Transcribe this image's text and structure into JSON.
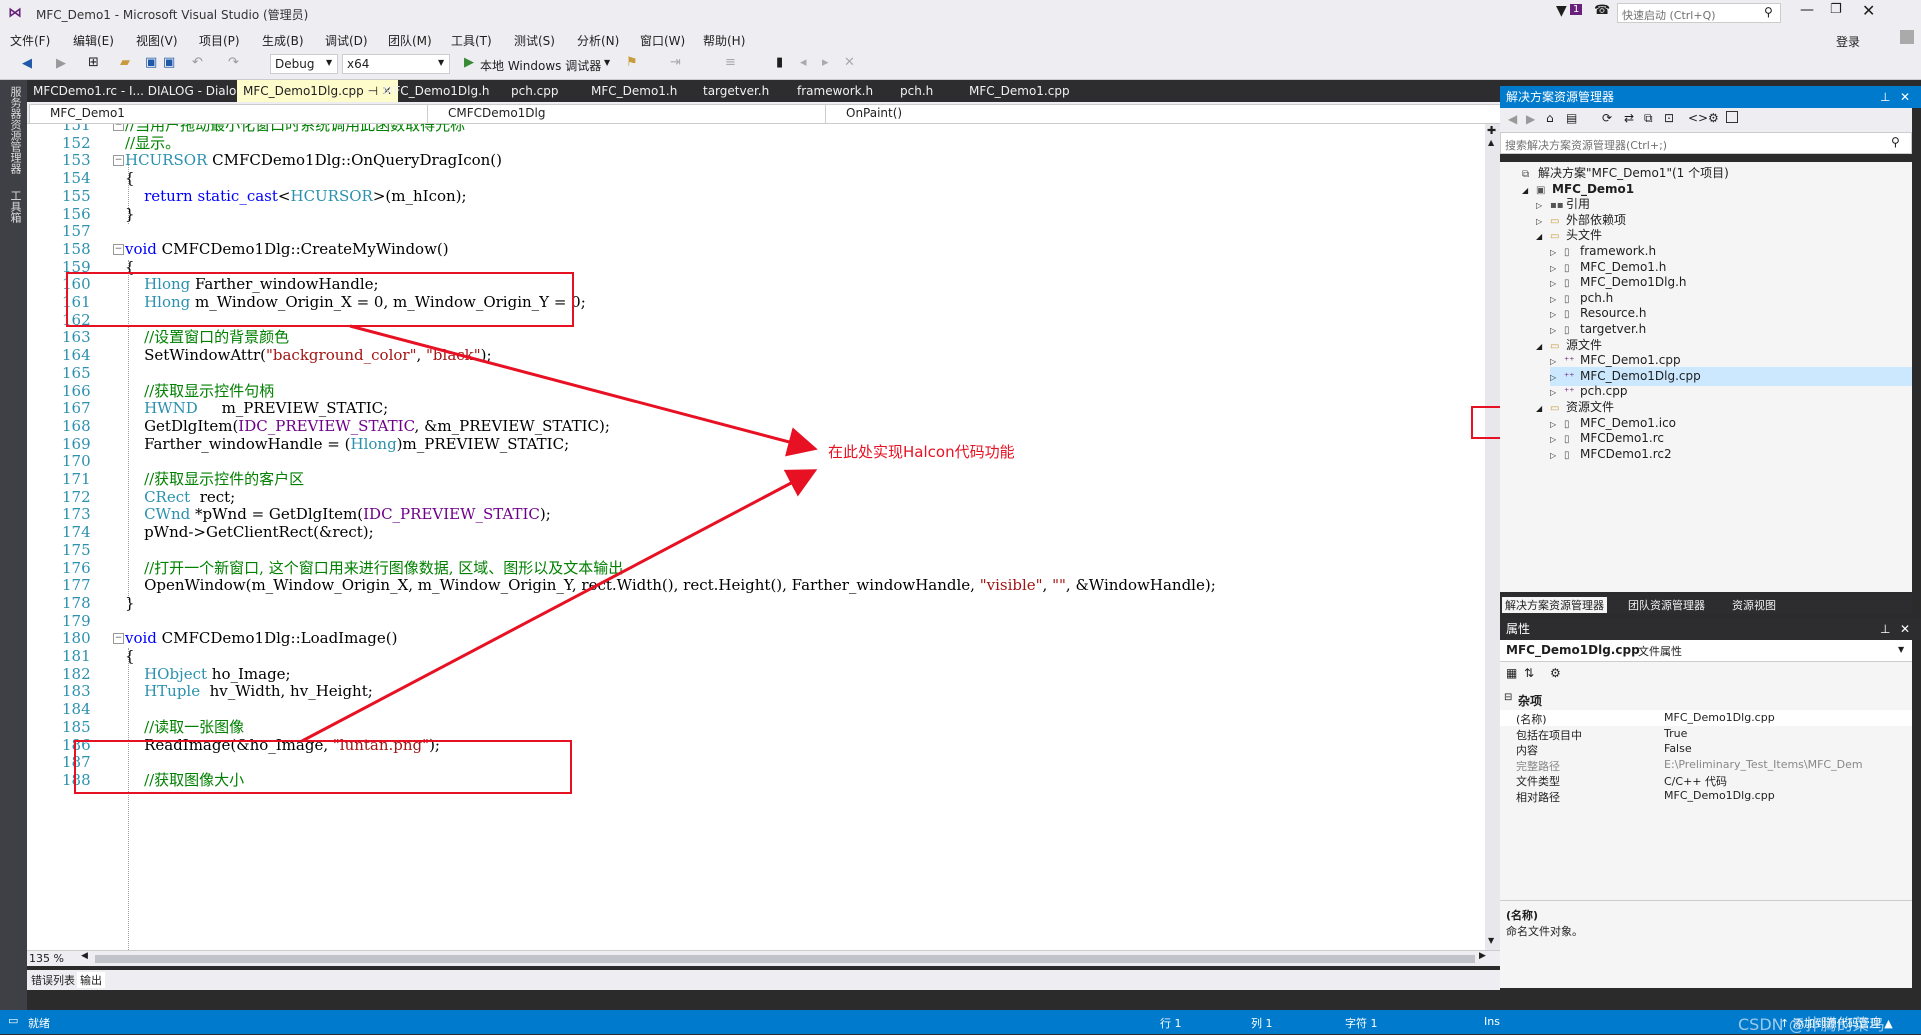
{
  "window": {
    "title": "MFC_Demo1 - Microsoft Visual Studio (管理员)",
    "quick_launch_placeholder": "快速启动 (Ctrl+Q)",
    "notification_count": "1",
    "login_label": "登录"
  },
  "menu": [
    "文件(F)",
    "编辑(E)",
    "视图(V)",
    "项目(P)",
    "生成(B)",
    "调试(D)",
    "团队(M)",
    "工具(T)",
    "测试(S)",
    "分析(N)",
    "窗口(W)",
    "帮助(H)"
  ],
  "toolbar": {
    "config": "Debug",
    "platform": "x64",
    "run_label": "本地 Windows 调试器"
  },
  "left_strip": {
    "label1": "服务器资源管理器",
    "label2": "工具箱"
  },
  "tabs": [
    "MFCDemo1.rc - I... DIALOG - Dialog",
    "MFC_Demo1Dlg.cpp",
    "MFC_Demo1Dlg.h",
    "pch.cpp",
    "MFC_Demo1.h",
    "targetver.h",
    "framework.h",
    "pch.h",
    "MFC_Demo1.cpp"
  ],
  "active_tab_index": 1,
  "nav": {
    "project": "MFC_Demo1",
    "class": "CMFCDemo1Dlg",
    "member": "OnPaint()"
  },
  "code": [
    {
      "n": "151",
      "t": [
        [
          "cm",
          "//当用户拖动最小化窗口时系统调用此函数取得光标"
        ]
      ]
    },
    {
      "n": "152",
      "t": [
        [
          "cm",
          "//显示。"
        ]
      ]
    },
    {
      "n": "153",
      "t": [
        [
          "ty",
          "HCURSOR"
        ],
        [
          "fn",
          " CMFCDemo1Dlg::OnQueryDragIcon()"
        ]
      ]
    },
    {
      "n": "154",
      "t": [
        [
          "fn",
          "{"
        ]
      ]
    },
    {
      "n": "155",
      "t": [
        [
          "fn",
          "    "
        ],
        [
          "kw",
          "return"
        ],
        [
          "fn",
          " "
        ],
        [
          "kw",
          "static_cast"
        ],
        [
          "fn",
          "<"
        ],
        [
          "ty",
          "HCURSOR"
        ],
        [
          "fn",
          ">(m_hIcon);"
        ]
      ]
    },
    {
      "n": "156",
      "t": [
        [
          "fn",
          "}"
        ]
      ]
    },
    {
      "n": "157",
      "t": []
    },
    {
      "n": "158",
      "t": [
        [
          "kw",
          "void"
        ],
        [
          "fn",
          " CMFCDemo1Dlg::CreateMyWindow()"
        ]
      ]
    },
    {
      "n": "159",
      "t": [
        [
          "fn",
          "{"
        ]
      ]
    },
    {
      "n": "160",
      "t": [
        [
          "fn",
          "    "
        ],
        [
          "ty",
          "Hlong"
        ],
        [
          "fn",
          " Farther_windowHandle;"
        ]
      ]
    },
    {
      "n": "161",
      "t": [
        [
          "fn",
          "    "
        ],
        [
          "ty",
          "Hlong"
        ],
        [
          "fn",
          " m_Window_Origin_X = 0, m_Window_Origin_Y = 0;"
        ]
      ]
    },
    {
      "n": "162",
      "t": []
    },
    {
      "n": "163",
      "t": [
        [
          "fn",
          "    "
        ],
        [
          "cm",
          "//设置窗口的背景颜色"
        ]
      ]
    },
    {
      "n": "164",
      "t": [
        [
          "fn",
          "    SetWindowAttr("
        ],
        [
          "st",
          "\"background_color\""
        ],
        [
          "fn",
          ", "
        ],
        [
          "st",
          "\"black\""
        ],
        [
          "fn",
          ");"
        ]
      ]
    },
    {
      "n": "165",
      "t": []
    },
    {
      "n": "166",
      "t": [
        [
          "fn",
          "    "
        ],
        [
          "cm",
          "//获取显示控件句柄"
        ]
      ]
    },
    {
      "n": "167",
      "t": [
        [
          "fn",
          "    "
        ],
        [
          "ty",
          "HWND"
        ],
        [
          "fn",
          "     m_PREVIEW_STATIC;"
        ]
      ]
    },
    {
      "n": "168",
      "t": [
        [
          "fn",
          "    GetDlgItem("
        ],
        [
          "mc",
          "IDC_PREVIEW_STATIC"
        ],
        [
          "fn",
          ", &m_PREVIEW_STATIC);"
        ]
      ]
    },
    {
      "n": "169",
      "t": [
        [
          "fn",
          "    Farther_windowHandle = ("
        ],
        [
          "ty",
          "Hlong"
        ],
        [
          "fn",
          ")m_PREVIEW_STATIC;"
        ]
      ]
    },
    {
      "n": "170",
      "t": []
    },
    {
      "n": "171",
      "t": [
        [
          "fn",
          "    "
        ],
        [
          "cm",
          "//获取显示控件的客户区"
        ]
      ]
    },
    {
      "n": "172",
      "t": [
        [
          "fn",
          "    "
        ],
        [
          "ty",
          "CRect"
        ],
        [
          "fn",
          "  rect;"
        ]
      ]
    },
    {
      "n": "173",
      "t": [
        [
          "fn",
          "    "
        ],
        [
          "ty",
          "CWnd"
        ],
        [
          "fn",
          " *pWnd = GetDlgItem("
        ],
        [
          "mc",
          "IDC_PREVIEW_STATIC"
        ],
        [
          "fn",
          ");"
        ]
      ]
    },
    {
      "n": "174",
      "t": [
        [
          "fn",
          "    pWnd->GetClientRect(&rect);"
        ]
      ]
    },
    {
      "n": "175",
      "t": []
    },
    {
      "n": "176",
      "t": [
        [
          "fn",
          "    "
        ],
        [
          "cm",
          "//打开一个新窗口, 这个窗口用来进行图像数据, 区域、图形以及文本输出"
        ]
      ]
    },
    {
      "n": "177",
      "t": [
        [
          "fn",
          "    OpenWindow(m_Window_Origin_X, m_Window_Origin_Y, rect.Width(), rect.Height(), Farther_windowHandle, "
        ],
        [
          "st",
          "\"visible\""
        ],
        [
          "fn",
          ", "
        ],
        [
          "st",
          "\"\""
        ],
        [
          "fn",
          ", &WindowHandle);"
        ]
      ]
    },
    {
      "n": "178",
      "t": [
        [
          "fn",
          "}"
        ]
      ]
    },
    {
      "n": "179",
      "t": []
    },
    {
      "n": "180",
      "t": [
        [
          "kw",
          "void"
        ],
        [
          "fn",
          " CMFCDemo1Dlg::LoadImage()"
        ]
      ]
    },
    {
      "n": "181",
      "t": [
        [
          "fn",
          "{"
        ]
      ]
    },
    {
      "n": "182",
      "t": [
        [
          "fn",
          "    "
        ],
        [
          "ty",
          "HObject"
        ],
        [
          "fn",
          " ho_Image;"
        ]
      ]
    },
    {
      "n": "183",
      "t": [
        [
          "fn",
          "    "
        ],
        [
          "ty",
          "HTuple"
        ],
        [
          "fn",
          "  hv_Width, hv_Height;"
        ]
      ]
    },
    {
      "n": "184",
      "t": []
    },
    {
      "n": "185",
      "t": [
        [
          "fn",
          "    "
        ],
        [
          "cm",
          "//读取一张图像"
        ]
      ]
    },
    {
      "n": "186",
      "t": [
        [
          "fn",
          "    ReadImage(&ho_Image, "
        ],
        [
          "st",
          "\"luntan.png\""
        ],
        [
          "fn",
          ");"
        ]
      ]
    },
    {
      "n": "187",
      "t": []
    },
    {
      "n": "188",
      "t": [
        [
          "fn",
          "    "
        ],
        [
          "cm",
          "//获取图像大小"
        ]
      ]
    }
  ],
  "annotation": "在此处实现Halcon代码功能",
  "zoom": "135 %",
  "bottom_tabs": [
    "错误列表",
    "输出"
  ],
  "status": {
    "ready": "就绪",
    "line": "行 1",
    "col": "列 1",
    "char": "字符 1",
    "ins": "Ins",
    "add_source": "↑ 添加到源代码管理 ▲",
    "watermark": "CSDN @扑腾的菜鸟"
  },
  "solution_explorer": {
    "title": "解决方案资源管理器",
    "search_placeholder": "搜索解决方案资源管理器(Ctrl+;)",
    "items": [
      {
        "label": "解决方案\"MFC_Demo1\"(1 个项目)",
        "level": 0,
        "bold": false,
        "icon": "solution-icon"
      },
      {
        "label": "MFC_Demo1",
        "level": 1,
        "bold": true,
        "icon": "project-icon"
      },
      {
        "label": "引用",
        "level": 2,
        "bold": false,
        "icon": "references-icon"
      },
      {
        "label": "外部依赖项",
        "level": 2,
        "bold": false,
        "icon": "folder-icon"
      },
      {
        "label": "头文件",
        "level": 2,
        "bold": false,
        "icon": "folder-icon"
      },
      {
        "label": "framework.h",
        "level": 3,
        "bold": false,
        "icon": "file-icon"
      },
      {
        "label": "MFC_Demo1.h",
        "level": 3,
        "bold": false,
        "icon": "file-icon"
      },
      {
        "label": "MFC_Demo1Dlg.h",
        "level": 3,
        "bold": false,
        "icon": "file-icon"
      },
      {
        "label": "pch.h",
        "level": 3,
        "bold": false,
        "icon": "file-icon"
      },
      {
        "label": "Resource.h",
        "level": 3,
        "bold": false,
        "icon": "file-icon"
      },
      {
        "label": "targetver.h",
        "level": 3,
        "bold": false,
        "icon": "file-icon"
      },
      {
        "label": "源文件",
        "level": 2,
        "bold": false,
        "icon": "folder-icon"
      },
      {
        "label": "MFC_Demo1.cpp",
        "level": 3,
        "bold": false,
        "icon": "cpp-file-icon"
      },
      {
        "label": "MFC_Demo1Dlg.cpp",
        "level": 3,
        "bold": false,
        "icon": "cpp-file-icon"
      },
      {
        "label": "pch.cpp",
        "level": 3,
        "bold": false,
        "icon": "cpp-file-icon"
      },
      {
        "label": "资源文件",
        "level": 2,
        "bold": false,
        "icon": "folder-icon"
      },
      {
        "label": "MFC_Demo1.ico",
        "level": 3,
        "bold": false,
        "icon": "file-icon"
      },
      {
        "label": "MFCDemo1.rc",
        "level": 3,
        "bold": false,
        "icon": "file-icon"
      },
      {
        "label": "MFCDemo1.rc2",
        "level": 3,
        "bold": false,
        "icon": "file-icon"
      }
    ],
    "selected_index": 13,
    "tabs": [
      "解决方案资源管理器",
      "团队资源管理器",
      "资源视图"
    ]
  },
  "properties": {
    "title": "属性",
    "subject": "MFC_Demo1Dlg.cpp",
    "subject_suffix": "文件属性",
    "section": "杂项",
    "rows": [
      {
        "k": "(名称)",
        "v": "MFC_Demo1Dlg.cpp",
        "dim": false
      },
      {
        "k": "包括在项目中",
        "v": "True",
        "dim": false
      },
      {
        "k": "内容",
        "v": "False",
        "dim": false
      },
      {
        "k": "完整路径",
        "v": "E:\\Preliminary_Test_Items\\MFC_Dem",
        "dim": true
      },
      {
        "k": "文件类型",
        "v": "C/C++ 代码",
        "dim": false
      },
      {
        "k": "相对路径",
        "v": "MFC_Demo1Dlg.cpp",
        "dim": false
      }
    ],
    "desc_title": "(名称)",
    "desc_text": "命名文件对象。"
  },
  "colors": {
    "accent": "#007acc",
    "annotation_red": "#e81123",
    "tab_active": "#fffccc"
  }
}
